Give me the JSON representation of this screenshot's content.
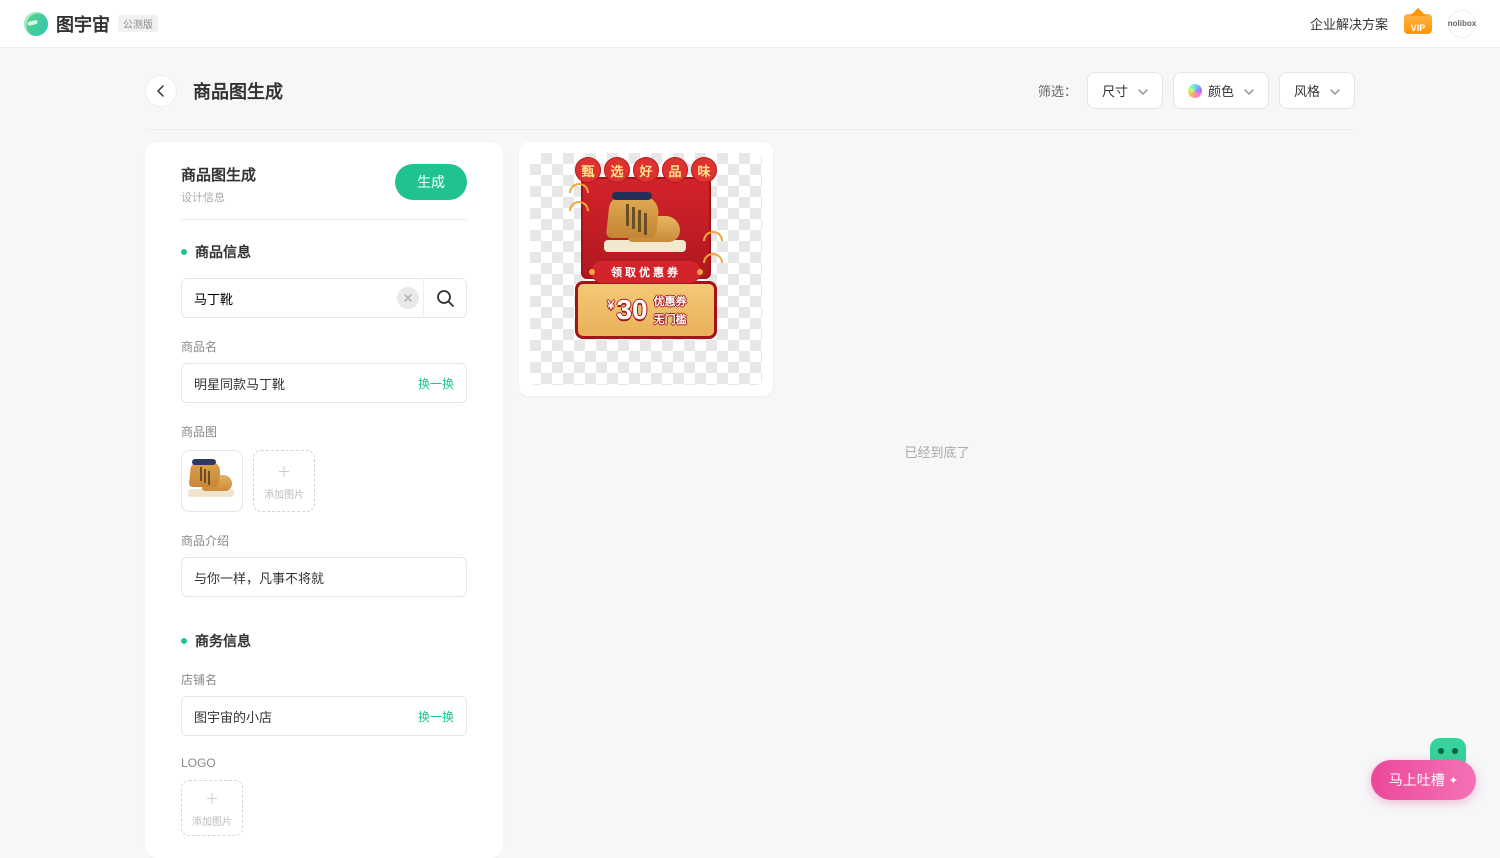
{
  "header": {
    "brand": "图宇宙",
    "beta": "公测版",
    "enterprise_link": "企业解决方案",
    "vip_text": "VIP",
    "avatar_text": "nolibox"
  },
  "page": {
    "title": "商品图生成"
  },
  "filters": {
    "label": "筛选：",
    "size": "尺寸",
    "color": "颜色",
    "style": "风格"
  },
  "panel": {
    "title": "商品图生成",
    "subtitle": "设计信息",
    "generate_btn": "生成",
    "section_product_info": "商品信息",
    "search_value": "马丁靴",
    "product_name_label": "商品名",
    "product_name_value": "明星同款马丁靴",
    "swap_text": "换一换",
    "product_image_label": "商品图",
    "add_image": "添加图片",
    "product_intro_label": "商品介绍",
    "product_intro_value": "与你一样，凡事不将就",
    "section_biz_info": "商务信息",
    "shop_name_label": "店铺名",
    "shop_name_value": "图宇宙的小店",
    "logo_label": "LOGO"
  },
  "promo": {
    "title_chars": [
      "甄",
      "选",
      "好",
      "品",
      "味"
    ],
    "banner": "领取优惠券",
    "price": "30",
    "currency": "￥",
    "coupon_line1": "优惠券",
    "coupon_line2": "无门槛"
  },
  "results": {
    "end": "已经到底了"
  },
  "feedback": {
    "text": "马上吐槽"
  }
}
